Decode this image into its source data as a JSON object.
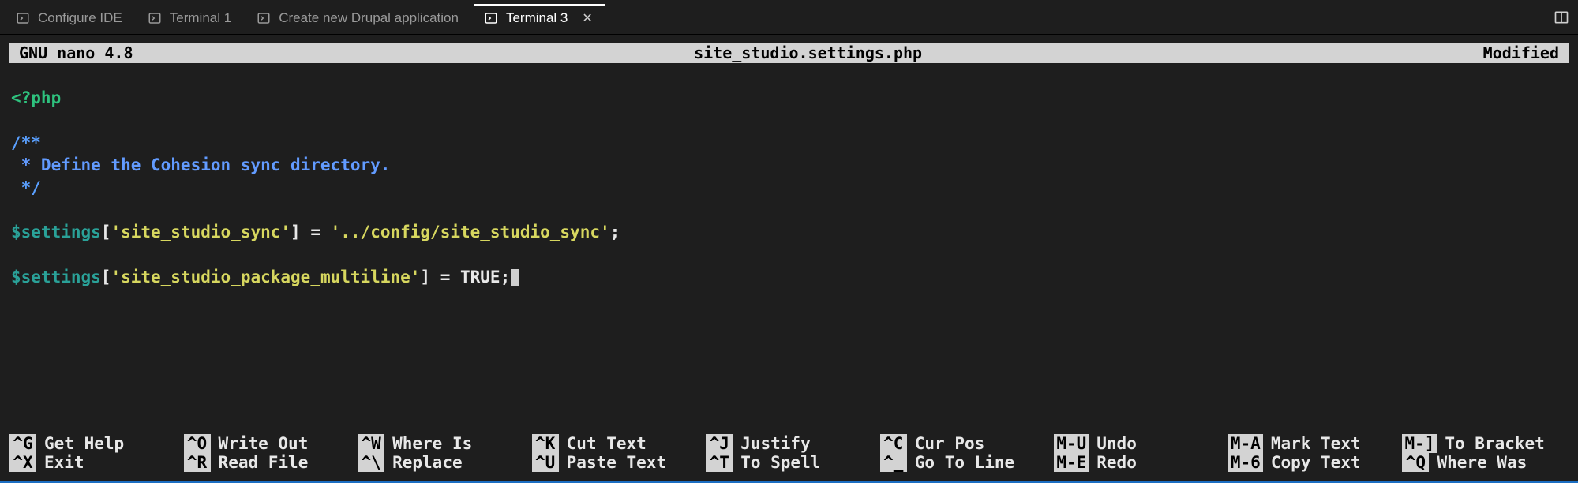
{
  "tabs": [
    {
      "label": "Configure IDE",
      "active": false
    },
    {
      "label": "Terminal 1",
      "active": false
    },
    {
      "label": "Create new Drupal application",
      "active": false
    },
    {
      "label": "Terminal 3",
      "active": true
    }
  ],
  "nano": {
    "version": "GNU nano 4.8",
    "filename": "site_studio.settings.php",
    "status": "Modified"
  },
  "code": {
    "php_open": "<?php",
    "doc_open": "/**",
    "doc_body": " * Define the Cohesion sync directory.",
    "doc_close": " */",
    "var1": "$settings",
    "br_open": "[",
    "br_close": "]",
    "key1": "'site_studio_sync'",
    "eq": " = ",
    "val1": "'../config/site_studio_sync'",
    "semi": ";",
    "key2": "'site_studio_package_multiline'",
    "val2": "TRUE"
  },
  "shortcuts": [
    [
      {
        "key": "^G",
        "label": "Get Help"
      },
      {
        "key": "^O",
        "label": "Write Out"
      },
      {
        "key": "^W",
        "label": "Where Is"
      },
      {
        "key": "^K",
        "label": "Cut Text"
      },
      {
        "key": "^J",
        "label": "Justify"
      },
      {
        "key": "^C",
        "label": "Cur Pos"
      },
      {
        "key": "M-U",
        "label": "Undo"
      },
      {
        "key": "M-A",
        "label": "Mark Text"
      },
      {
        "key": "M-]",
        "label": "To Bracket"
      }
    ],
    [
      {
        "key": "^X",
        "label": "Exit"
      },
      {
        "key": "^R",
        "label": "Read File"
      },
      {
        "key": "^\\",
        "label": "Replace"
      },
      {
        "key": "^U",
        "label": "Paste Text"
      },
      {
        "key": "^T",
        "label": "To Spell"
      },
      {
        "key": "^_",
        "label": "Go To Line"
      },
      {
        "key": "M-E",
        "label": "Redo"
      },
      {
        "key": "M-6",
        "label": "Copy Text"
      },
      {
        "key": "^Q",
        "label": "Where Was"
      }
    ]
  ]
}
